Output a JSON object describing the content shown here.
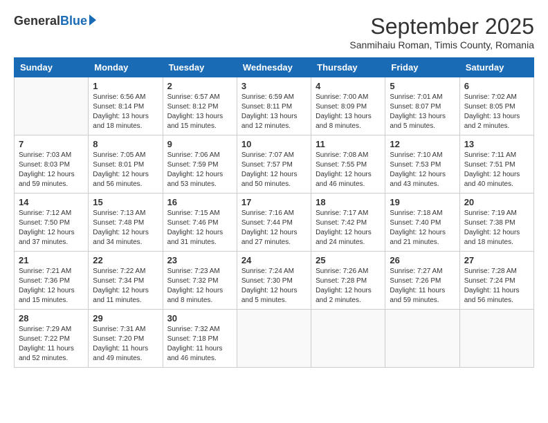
{
  "logo": {
    "general": "General",
    "blue": "Blue"
  },
  "title": "September 2025",
  "subtitle": "Sanmihaiu Roman, Timis County, Romania",
  "days_of_week": [
    "Sunday",
    "Monday",
    "Tuesday",
    "Wednesday",
    "Thursday",
    "Friday",
    "Saturday"
  ],
  "weeks": [
    [
      {
        "day": "",
        "info": ""
      },
      {
        "day": "1",
        "info": "Sunrise: 6:56 AM\nSunset: 8:14 PM\nDaylight: 13 hours\nand 18 minutes."
      },
      {
        "day": "2",
        "info": "Sunrise: 6:57 AM\nSunset: 8:12 PM\nDaylight: 13 hours\nand 15 minutes."
      },
      {
        "day": "3",
        "info": "Sunrise: 6:59 AM\nSunset: 8:11 PM\nDaylight: 13 hours\nand 12 minutes."
      },
      {
        "day": "4",
        "info": "Sunrise: 7:00 AM\nSunset: 8:09 PM\nDaylight: 13 hours\nand 8 minutes."
      },
      {
        "day": "5",
        "info": "Sunrise: 7:01 AM\nSunset: 8:07 PM\nDaylight: 13 hours\nand 5 minutes."
      },
      {
        "day": "6",
        "info": "Sunrise: 7:02 AM\nSunset: 8:05 PM\nDaylight: 13 hours\nand 2 minutes."
      }
    ],
    [
      {
        "day": "7",
        "info": "Sunrise: 7:03 AM\nSunset: 8:03 PM\nDaylight: 12 hours\nand 59 minutes."
      },
      {
        "day": "8",
        "info": "Sunrise: 7:05 AM\nSunset: 8:01 PM\nDaylight: 12 hours\nand 56 minutes."
      },
      {
        "day": "9",
        "info": "Sunrise: 7:06 AM\nSunset: 7:59 PM\nDaylight: 12 hours\nand 53 minutes."
      },
      {
        "day": "10",
        "info": "Sunrise: 7:07 AM\nSunset: 7:57 PM\nDaylight: 12 hours\nand 50 minutes."
      },
      {
        "day": "11",
        "info": "Sunrise: 7:08 AM\nSunset: 7:55 PM\nDaylight: 12 hours\nand 46 minutes."
      },
      {
        "day": "12",
        "info": "Sunrise: 7:10 AM\nSunset: 7:53 PM\nDaylight: 12 hours\nand 43 minutes."
      },
      {
        "day": "13",
        "info": "Sunrise: 7:11 AM\nSunset: 7:51 PM\nDaylight: 12 hours\nand 40 minutes."
      }
    ],
    [
      {
        "day": "14",
        "info": "Sunrise: 7:12 AM\nSunset: 7:50 PM\nDaylight: 12 hours\nand 37 minutes."
      },
      {
        "day": "15",
        "info": "Sunrise: 7:13 AM\nSunset: 7:48 PM\nDaylight: 12 hours\nand 34 minutes."
      },
      {
        "day": "16",
        "info": "Sunrise: 7:15 AM\nSunset: 7:46 PM\nDaylight: 12 hours\nand 31 minutes."
      },
      {
        "day": "17",
        "info": "Sunrise: 7:16 AM\nSunset: 7:44 PM\nDaylight: 12 hours\nand 27 minutes."
      },
      {
        "day": "18",
        "info": "Sunrise: 7:17 AM\nSunset: 7:42 PM\nDaylight: 12 hours\nand 24 minutes."
      },
      {
        "day": "19",
        "info": "Sunrise: 7:18 AM\nSunset: 7:40 PM\nDaylight: 12 hours\nand 21 minutes."
      },
      {
        "day": "20",
        "info": "Sunrise: 7:19 AM\nSunset: 7:38 PM\nDaylight: 12 hours\nand 18 minutes."
      }
    ],
    [
      {
        "day": "21",
        "info": "Sunrise: 7:21 AM\nSunset: 7:36 PM\nDaylight: 12 hours\nand 15 minutes."
      },
      {
        "day": "22",
        "info": "Sunrise: 7:22 AM\nSunset: 7:34 PM\nDaylight: 12 hours\nand 11 minutes."
      },
      {
        "day": "23",
        "info": "Sunrise: 7:23 AM\nSunset: 7:32 PM\nDaylight: 12 hours\nand 8 minutes."
      },
      {
        "day": "24",
        "info": "Sunrise: 7:24 AM\nSunset: 7:30 PM\nDaylight: 12 hours\nand 5 minutes."
      },
      {
        "day": "25",
        "info": "Sunrise: 7:26 AM\nSunset: 7:28 PM\nDaylight: 12 hours\nand 2 minutes."
      },
      {
        "day": "26",
        "info": "Sunrise: 7:27 AM\nSunset: 7:26 PM\nDaylight: 11 hours\nand 59 minutes."
      },
      {
        "day": "27",
        "info": "Sunrise: 7:28 AM\nSunset: 7:24 PM\nDaylight: 11 hours\nand 56 minutes."
      }
    ],
    [
      {
        "day": "28",
        "info": "Sunrise: 7:29 AM\nSunset: 7:22 PM\nDaylight: 11 hours\nand 52 minutes."
      },
      {
        "day": "29",
        "info": "Sunrise: 7:31 AM\nSunset: 7:20 PM\nDaylight: 11 hours\nand 49 minutes."
      },
      {
        "day": "30",
        "info": "Sunrise: 7:32 AM\nSunset: 7:18 PM\nDaylight: 11 hours\nand 46 minutes."
      },
      {
        "day": "",
        "info": ""
      },
      {
        "day": "",
        "info": ""
      },
      {
        "day": "",
        "info": ""
      },
      {
        "day": "",
        "info": ""
      }
    ]
  ]
}
